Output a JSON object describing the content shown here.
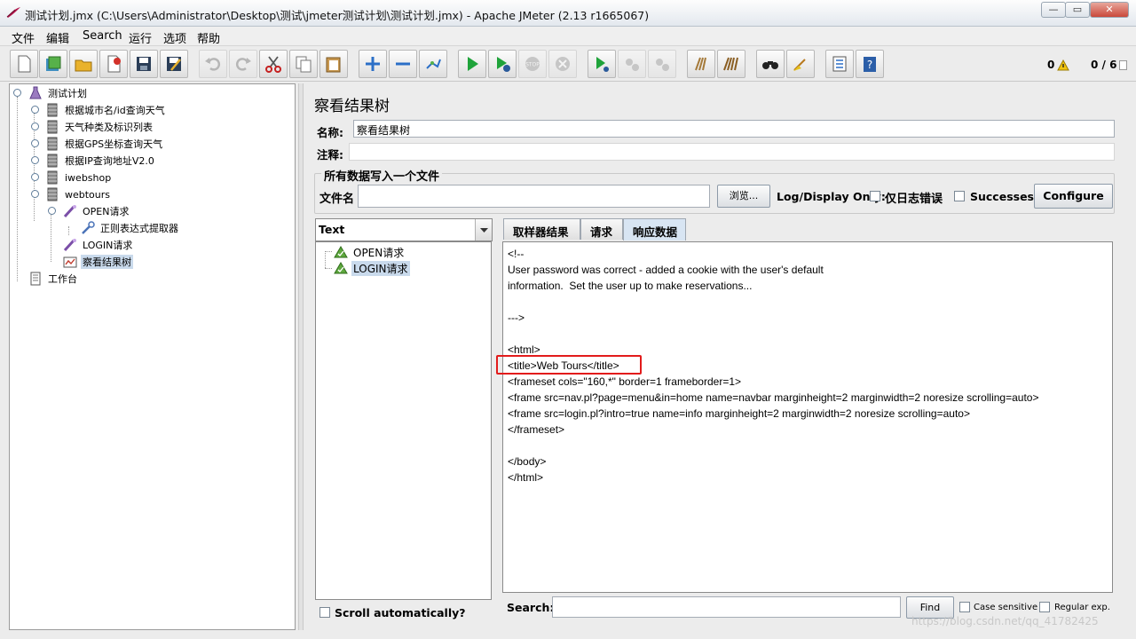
{
  "window": {
    "title": "测试计划.jmx (C:\\Users\\Administrator\\Desktop\\测试\\jmeter测试计划\\测试计划.jmx) - Apache JMeter (2.13 r1665067)",
    "controls": {
      "minimize": "—",
      "restore": "▭",
      "close": "✕"
    }
  },
  "menubar": [
    "文件",
    "编辑",
    "Search",
    "运行",
    "选项",
    "帮助"
  ],
  "toolbar": {
    "warn_count": "0",
    "thread_count": "0 / 6",
    "icons": [
      "new-icon",
      "templates-icon",
      "open-icon",
      "close-icon",
      "save-icon",
      "save-as-icon",
      "undo-icon",
      "redo-icon",
      "cut-icon",
      "copy-icon",
      "paste-icon",
      "expand-icon",
      "collapse-icon",
      "toggle-icon",
      "start-icon",
      "start-no-timers-icon",
      "stop-icon",
      "shutdown-icon",
      "remote-start-icon",
      "remote-stop-icon",
      "remote-shutdown-icon",
      "clear-icon",
      "clear-all-icon",
      "search-icon",
      "reset-search-icon",
      "function-helper-icon",
      "help-icon"
    ]
  },
  "tree": {
    "nodes": [
      {
        "label": "测试计划",
        "icon": "test-plan-icon"
      },
      {
        "label": "根据城市名/id查询天气",
        "icon": "thread-group-icon"
      },
      {
        "label": "天气种类及标识列表",
        "icon": "thread-group-icon"
      },
      {
        "label": "根据GPS坐标查询天气",
        "icon": "thread-group-icon"
      },
      {
        "label": "根据IP查询地址V2.0",
        "icon": "thread-group-icon"
      },
      {
        "label": "iwebshop",
        "icon": "thread-group-icon"
      },
      {
        "label": "webtours",
        "icon": "thread-group-icon"
      },
      {
        "label": "OPEN请求",
        "icon": "http-sampler-icon"
      },
      {
        "label": "正则表达式提取器",
        "icon": "regex-extractor-icon"
      },
      {
        "label": "LOGIN请求",
        "icon": "http-sampler-icon"
      },
      {
        "label": "察看结果树",
        "icon": "view-results-tree-icon"
      },
      {
        "label": "工作台",
        "icon": "workbench-icon"
      }
    ]
  },
  "panel": {
    "title": "察看结果树",
    "name_label": "名称:",
    "name_value": "察看结果树",
    "comment_label": "注释:",
    "comment_value": "",
    "file_group_title": "所有数据写入一个文件",
    "filename_label": "文件名",
    "filename_value": "",
    "browse_button": "浏览...",
    "log_display_label": "Log/Display Only:",
    "errors_only_label": "仅日志错误",
    "successes_label": "Successes",
    "configure_button": "Configure"
  },
  "results": {
    "renderer": "Text",
    "samples": [
      {
        "label": "OPEN请求",
        "selected": false
      },
      {
        "label": "LOGIN请求",
        "selected": true
      }
    ],
    "scroll_auto_label": "Scroll automatically?"
  },
  "tabs": [
    "取样器结果",
    "请求",
    "响应数据"
  ],
  "active_tab": 2,
  "response_lines": [
    "<!--",
    "User password was correct - added a cookie with the user's default",
    "information.  Set the user up to make reservations...",
    "",
    "--->",
    "",
    "<html>",
    "<title>Web Tours</title>",
    "<frameset cols=\"160,*\" border=1 frameborder=1>",
    "<frame src=nav.pl?page=menu&in=home name=navbar marginheight=2 marginwidth=2 noresize scrolling=auto>",
    "<frame src=login.pl?intro=true name=info marginheight=2 marginwidth=2 noresize scrolling=auto>",
    "</frameset>",
    "",
    "</body>",
    "</html>"
  ],
  "search": {
    "label": "Search:",
    "value": "",
    "find_button": "Find",
    "case_sensitive_label": "Case sensitive",
    "regular_exp_label": "Regular exp."
  },
  "watermark": "https://blog.csdn.net/qq_41782425",
  "colors": {
    "highlight_box": "#e21b1b",
    "selection": "#c9daec",
    "active_tab": "#d8e5f3"
  }
}
